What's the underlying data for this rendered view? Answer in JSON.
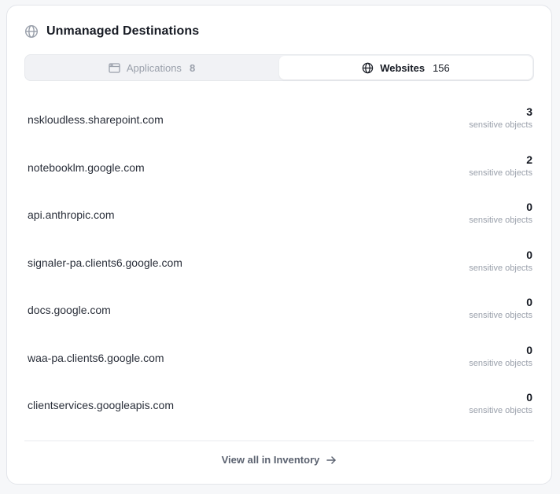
{
  "header": {
    "title": "Unmanaged Destinations",
    "icon": "globe-icon"
  },
  "tabs": [
    {
      "label": "Applications",
      "count": "8",
      "icon": "app-window-icon",
      "active": false
    },
    {
      "label": "Websites",
      "count": "156",
      "icon": "globe-icon",
      "active": true
    }
  ],
  "rows": [
    {
      "domain": "nskloudless.sharepoint.com",
      "count": "3",
      "sub": "sensitive objects"
    },
    {
      "domain": "notebooklm.google.com",
      "count": "2",
      "sub": "sensitive objects"
    },
    {
      "domain": "api.anthropic.com",
      "count": "0",
      "sub": "sensitive objects"
    },
    {
      "domain": "signaler-pa.clients6.google.com",
      "count": "0",
      "sub": "sensitive objects"
    },
    {
      "domain": "docs.google.com",
      "count": "0",
      "sub": "sensitive objects"
    },
    {
      "domain": "waa-pa.clients6.google.com",
      "count": "0",
      "sub": "sensitive objects"
    },
    {
      "domain": "clientservices.googleapis.com",
      "count": "0",
      "sub": "sensitive objects"
    }
  ],
  "footer": {
    "label": "View all in Inventory",
    "icon": "arrow-right-icon"
  },
  "colors": {
    "text_primary": "#161a23",
    "text_muted": "#9aa0ab",
    "tab_bg": "#f1f2f5",
    "card_bg": "#ffffff"
  }
}
